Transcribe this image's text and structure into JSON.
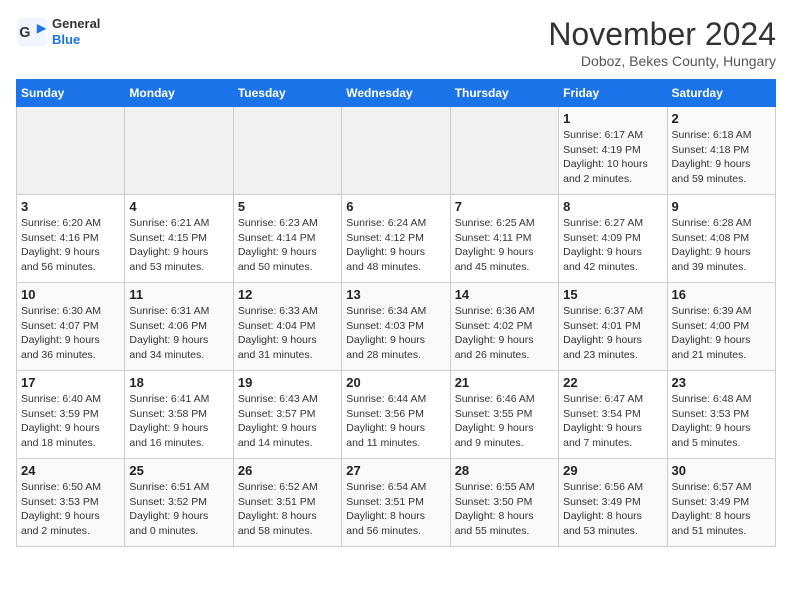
{
  "header": {
    "logo_line1": "General",
    "logo_line2": "Blue",
    "month": "November 2024",
    "location": "Doboz, Bekes County, Hungary"
  },
  "weekdays": [
    "Sunday",
    "Monday",
    "Tuesday",
    "Wednesday",
    "Thursday",
    "Friday",
    "Saturday"
  ],
  "weeks": [
    [
      {
        "day": "",
        "info": ""
      },
      {
        "day": "",
        "info": ""
      },
      {
        "day": "",
        "info": ""
      },
      {
        "day": "",
        "info": ""
      },
      {
        "day": "",
        "info": ""
      },
      {
        "day": "1",
        "info": "Sunrise: 6:17 AM\nSunset: 4:19 PM\nDaylight: 10 hours\nand 2 minutes."
      },
      {
        "day": "2",
        "info": "Sunrise: 6:18 AM\nSunset: 4:18 PM\nDaylight: 9 hours\nand 59 minutes."
      }
    ],
    [
      {
        "day": "3",
        "info": "Sunrise: 6:20 AM\nSunset: 4:16 PM\nDaylight: 9 hours\nand 56 minutes."
      },
      {
        "day": "4",
        "info": "Sunrise: 6:21 AM\nSunset: 4:15 PM\nDaylight: 9 hours\nand 53 minutes."
      },
      {
        "day": "5",
        "info": "Sunrise: 6:23 AM\nSunset: 4:14 PM\nDaylight: 9 hours\nand 50 minutes."
      },
      {
        "day": "6",
        "info": "Sunrise: 6:24 AM\nSunset: 4:12 PM\nDaylight: 9 hours\nand 48 minutes."
      },
      {
        "day": "7",
        "info": "Sunrise: 6:25 AM\nSunset: 4:11 PM\nDaylight: 9 hours\nand 45 minutes."
      },
      {
        "day": "8",
        "info": "Sunrise: 6:27 AM\nSunset: 4:09 PM\nDaylight: 9 hours\nand 42 minutes."
      },
      {
        "day": "9",
        "info": "Sunrise: 6:28 AM\nSunset: 4:08 PM\nDaylight: 9 hours\nand 39 minutes."
      }
    ],
    [
      {
        "day": "10",
        "info": "Sunrise: 6:30 AM\nSunset: 4:07 PM\nDaylight: 9 hours\nand 36 minutes."
      },
      {
        "day": "11",
        "info": "Sunrise: 6:31 AM\nSunset: 4:06 PM\nDaylight: 9 hours\nand 34 minutes."
      },
      {
        "day": "12",
        "info": "Sunrise: 6:33 AM\nSunset: 4:04 PM\nDaylight: 9 hours\nand 31 minutes."
      },
      {
        "day": "13",
        "info": "Sunrise: 6:34 AM\nSunset: 4:03 PM\nDaylight: 9 hours\nand 28 minutes."
      },
      {
        "day": "14",
        "info": "Sunrise: 6:36 AM\nSunset: 4:02 PM\nDaylight: 9 hours\nand 26 minutes."
      },
      {
        "day": "15",
        "info": "Sunrise: 6:37 AM\nSunset: 4:01 PM\nDaylight: 9 hours\nand 23 minutes."
      },
      {
        "day": "16",
        "info": "Sunrise: 6:39 AM\nSunset: 4:00 PM\nDaylight: 9 hours\nand 21 minutes."
      }
    ],
    [
      {
        "day": "17",
        "info": "Sunrise: 6:40 AM\nSunset: 3:59 PM\nDaylight: 9 hours\nand 18 minutes."
      },
      {
        "day": "18",
        "info": "Sunrise: 6:41 AM\nSunset: 3:58 PM\nDaylight: 9 hours\nand 16 minutes."
      },
      {
        "day": "19",
        "info": "Sunrise: 6:43 AM\nSunset: 3:57 PM\nDaylight: 9 hours\nand 14 minutes."
      },
      {
        "day": "20",
        "info": "Sunrise: 6:44 AM\nSunset: 3:56 PM\nDaylight: 9 hours\nand 11 minutes."
      },
      {
        "day": "21",
        "info": "Sunrise: 6:46 AM\nSunset: 3:55 PM\nDaylight: 9 hours\nand 9 minutes."
      },
      {
        "day": "22",
        "info": "Sunrise: 6:47 AM\nSunset: 3:54 PM\nDaylight: 9 hours\nand 7 minutes."
      },
      {
        "day": "23",
        "info": "Sunrise: 6:48 AM\nSunset: 3:53 PM\nDaylight: 9 hours\nand 5 minutes."
      }
    ],
    [
      {
        "day": "24",
        "info": "Sunrise: 6:50 AM\nSunset: 3:53 PM\nDaylight: 9 hours\nand 2 minutes."
      },
      {
        "day": "25",
        "info": "Sunrise: 6:51 AM\nSunset: 3:52 PM\nDaylight: 9 hours\nand 0 minutes."
      },
      {
        "day": "26",
        "info": "Sunrise: 6:52 AM\nSunset: 3:51 PM\nDaylight: 8 hours\nand 58 minutes."
      },
      {
        "day": "27",
        "info": "Sunrise: 6:54 AM\nSunset: 3:51 PM\nDaylight: 8 hours\nand 56 minutes."
      },
      {
        "day": "28",
        "info": "Sunrise: 6:55 AM\nSunset: 3:50 PM\nDaylight: 8 hours\nand 55 minutes."
      },
      {
        "day": "29",
        "info": "Sunrise: 6:56 AM\nSunset: 3:49 PM\nDaylight: 8 hours\nand 53 minutes."
      },
      {
        "day": "30",
        "info": "Sunrise: 6:57 AM\nSunset: 3:49 PM\nDaylight: 8 hours\nand 51 minutes."
      }
    ]
  ]
}
